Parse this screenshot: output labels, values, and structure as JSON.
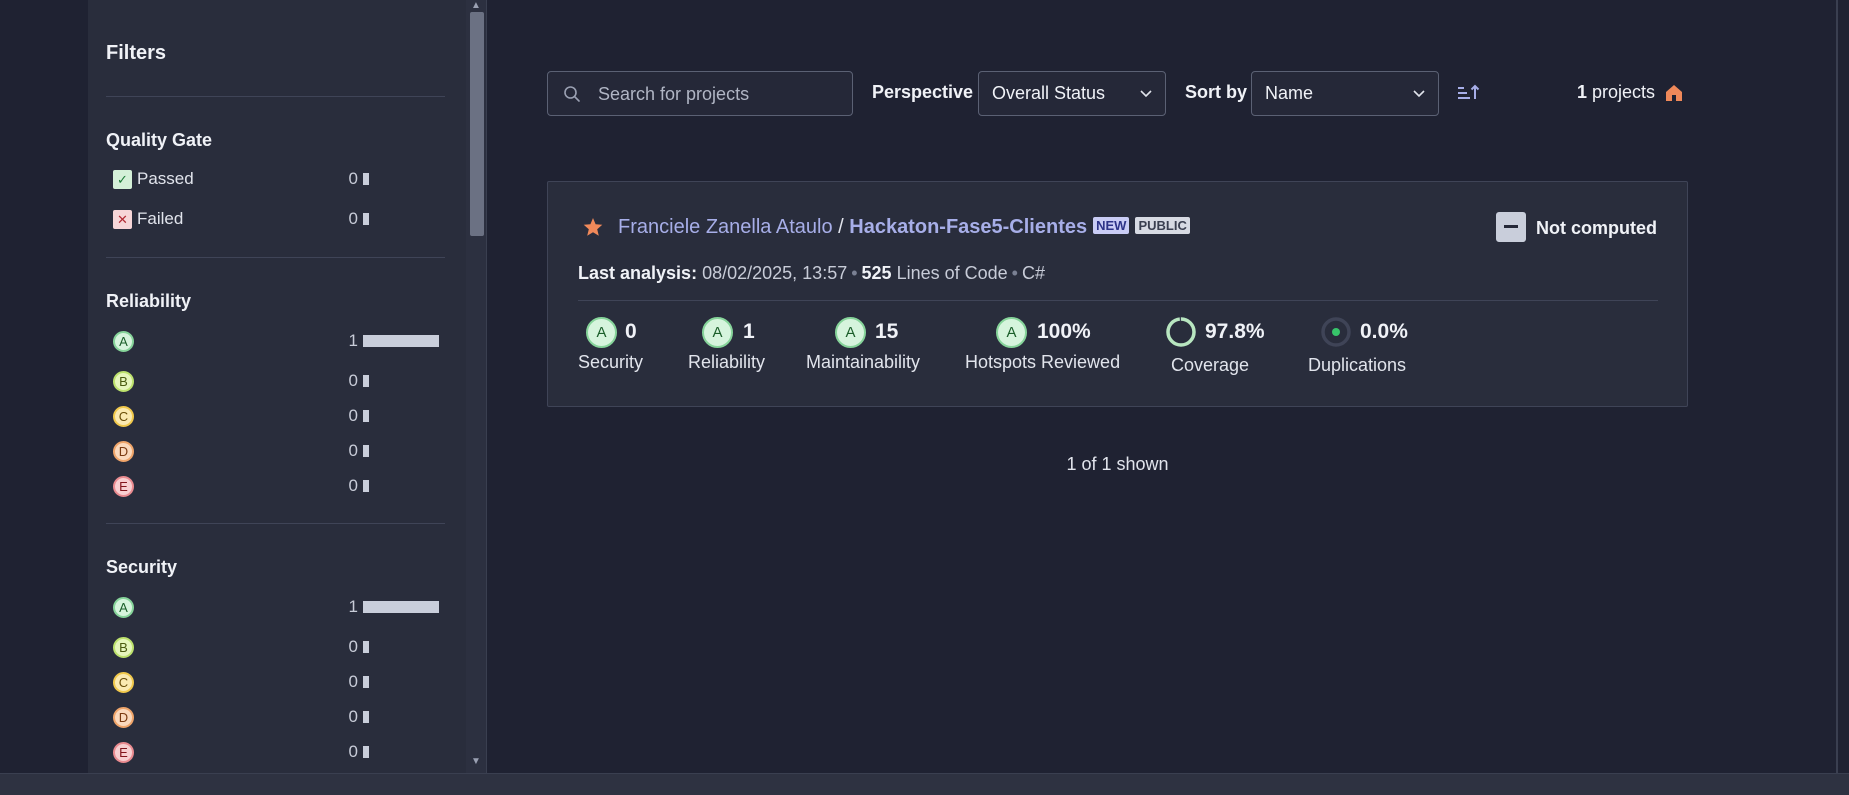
{
  "sidebar": {
    "title": "Filters",
    "quality_gate": {
      "title": "Quality Gate",
      "items": [
        {
          "label": "Passed",
          "count": "0",
          "icon": "check-icon"
        },
        {
          "label": "Failed",
          "count": "0",
          "icon": "cross-icon"
        }
      ]
    },
    "reliability": {
      "title": "Reliability",
      "items": [
        {
          "rating": "A",
          "count": "1"
        },
        {
          "rating": "B",
          "count": "0"
        },
        {
          "rating": "C",
          "count": "0"
        },
        {
          "rating": "D",
          "count": "0"
        },
        {
          "rating": "E",
          "count": "0"
        }
      ]
    },
    "security": {
      "title": "Security",
      "items": [
        {
          "rating": "A",
          "count": "1"
        },
        {
          "rating": "B",
          "count": "0"
        },
        {
          "rating": "C",
          "count": "0"
        },
        {
          "rating": "D",
          "count": "0"
        },
        {
          "rating": "E",
          "count": "0"
        }
      ]
    }
  },
  "toolbar": {
    "search_placeholder": "Search for projects",
    "perspective_label": "Perspective",
    "perspective_value": "Overall Status",
    "sort_label": "Sort by",
    "sort_value": "Name",
    "project_count": "1",
    "project_count_suffix": " projects"
  },
  "project": {
    "org": "Franciele Zanella Ataulo",
    "separator": " / ",
    "name": "Hackaton-Fase5-Clientes",
    "badge_new": "NEW",
    "badge_public": "PUBLIC",
    "quality_gate_status": "Not computed",
    "last_analysis_label": "Last analysis:",
    "last_analysis_value": "08/02/2025, 13:57",
    "loc_value": "525",
    "loc_label": "Lines of Code",
    "language": "C#",
    "metrics": {
      "security": {
        "rating": "A",
        "value": "0",
        "label": "Security"
      },
      "reliability": {
        "rating": "A",
        "value": "1",
        "label": "Reliability"
      },
      "maintainability": {
        "rating": "A",
        "value": "15",
        "label": "Maintainability"
      },
      "hotspots": {
        "rating": "A",
        "value": "100%",
        "label": "Hotspots Reviewed"
      },
      "coverage": {
        "value": "97.8%",
        "label": "Coverage",
        "percent": 97.8
      },
      "duplications": {
        "value": "0.0%",
        "label": "Duplications"
      }
    }
  },
  "pagination": {
    "shown": "1 of 1 shown"
  },
  "colors": {
    "background": "#1f2232",
    "panel": "#292d3c",
    "link": "#a7aee8",
    "star": "#f0895a",
    "home": "#f0895a"
  }
}
